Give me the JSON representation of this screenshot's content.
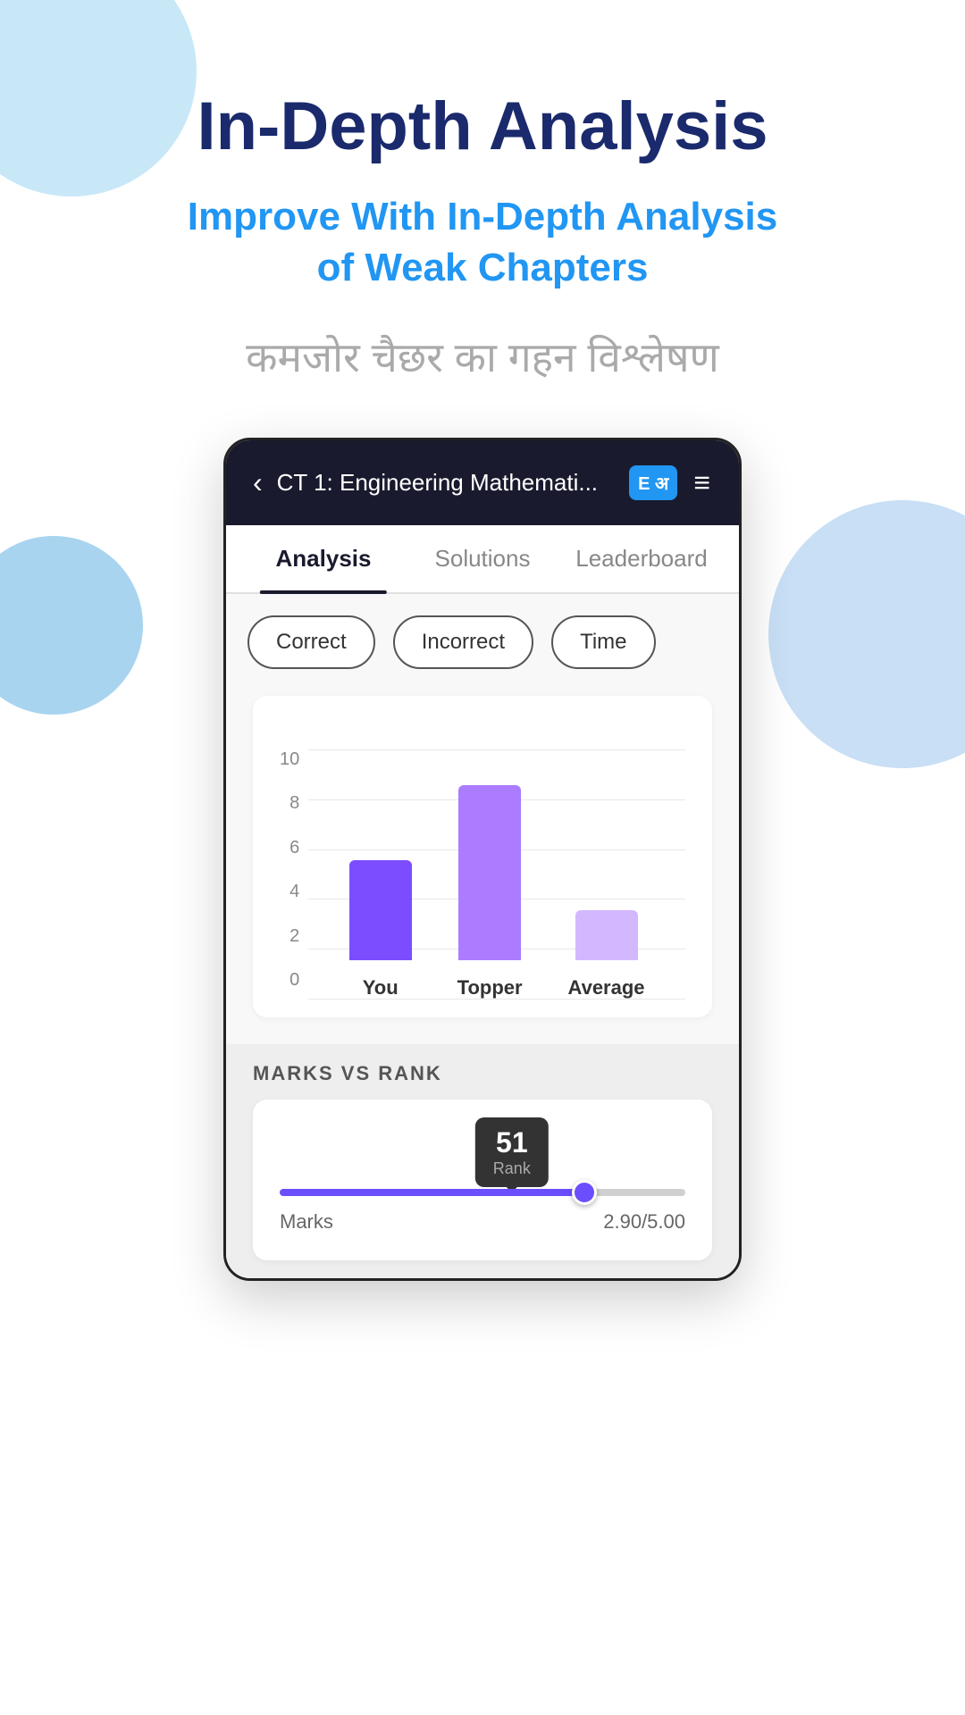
{
  "page": {
    "background_circles": {
      "top_left": "#c8e8f8",
      "middle_left": "#a8d4f0",
      "bottom_right": "#c8dff5"
    }
  },
  "header": {
    "main_title": "In-Depth Analysis",
    "sub_title_line1": "Improve With In-Depth Analysis",
    "sub_title_line2": "of Weak Chapters",
    "hindi_text": "कमजोर चैछर का गहन विश्लेषण"
  },
  "phone": {
    "header": {
      "back_icon": "‹",
      "title": "CT 1: Engineering Mathemati...",
      "book_icon": "E अ",
      "menu_icon": "≡"
    },
    "tabs": [
      {
        "label": "Analysis",
        "active": true
      },
      {
        "label": "Solutions",
        "active": false
      },
      {
        "label": "Leaderboard",
        "active": false
      }
    ],
    "filter_buttons": [
      {
        "label": "Correct",
        "active": false
      },
      {
        "label": "Incorrect",
        "active": false
      },
      {
        "label": "Time",
        "active": false
      }
    ],
    "chart": {
      "y_labels": [
        "10",
        "8",
        "6",
        "4",
        "2",
        "0"
      ],
      "bars": [
        {
          "label": "You",
          "height_percent": 40,
          "color": "#7c4dff"
        },
        {
          "label": "Topper",
          "height_percent": 70,
          "color": "#ab7cff"
        },
        {
          "label": "Average",
          "height_percent": 20,
          "color": "#d4b8ff"
        }
      ]
    },
    "marks_vs_rank": {
      "section_title": "MARKS VS RANK",
      "rank_value": "51",
      "rank_label": "Rank",
      "slider_position_percent": 75,
      "marks_label": "Marks",
      "marks_value": "2.90/5.00"
    }
  }
}
